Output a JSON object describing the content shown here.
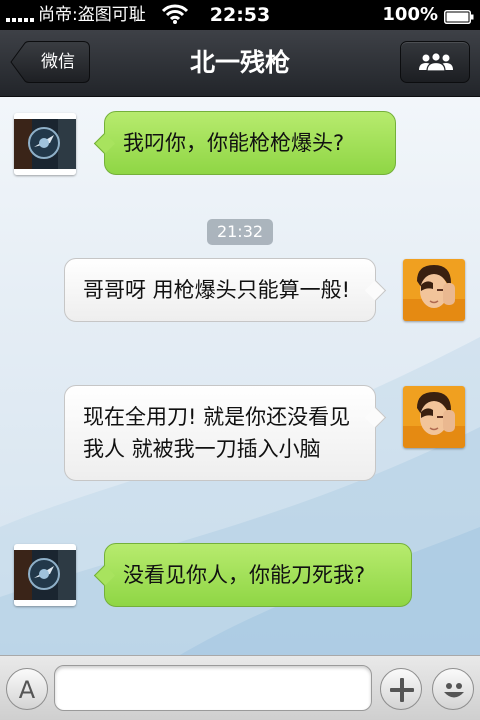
{
  "status_bar": {
    "carrier": "尚帝:盗图可耻",
    "time": "22:53",
    "battery": "100%",
    "icons": [
      "signal-icon",
      "wifi-icon",
      "battery-icon"
    ]
  },
  "nav": {
    "back_label": "微信",
    "title": "北一残枪",
    "members_icon": "group-icon"
  },
  "chat": {
    "timestamp": "21:32",
    "messages": [
      {
        "side": "left",
        "text": "我叼你，你能枪枪爆头?"
      },
      {
        "side": "right",
        "text": "哥哥呀 用枪爆头只能算一般!"
      },
      {
        "side": "right",
        "text": "现在全用刀! 就是你还没看见我人 就被我一刀插入小脑"
      },
      {
        "side": "left",
        "text": "没看见你人，你能刀死我?"
      }
    ]
  },
  "input_bar": {
    "voice_button_icon": "keyboard-a-icon",
    "input_value": "",
    "plus_icon": "plus-icon",
    "emoji_icon": "smiley-icon"
  },
  "colors": {
    "sent_bubble": "#9edc52",
    "received_bubble": "#f7f7f7",
    "nav_bar": "#2f3237"
  }
}
